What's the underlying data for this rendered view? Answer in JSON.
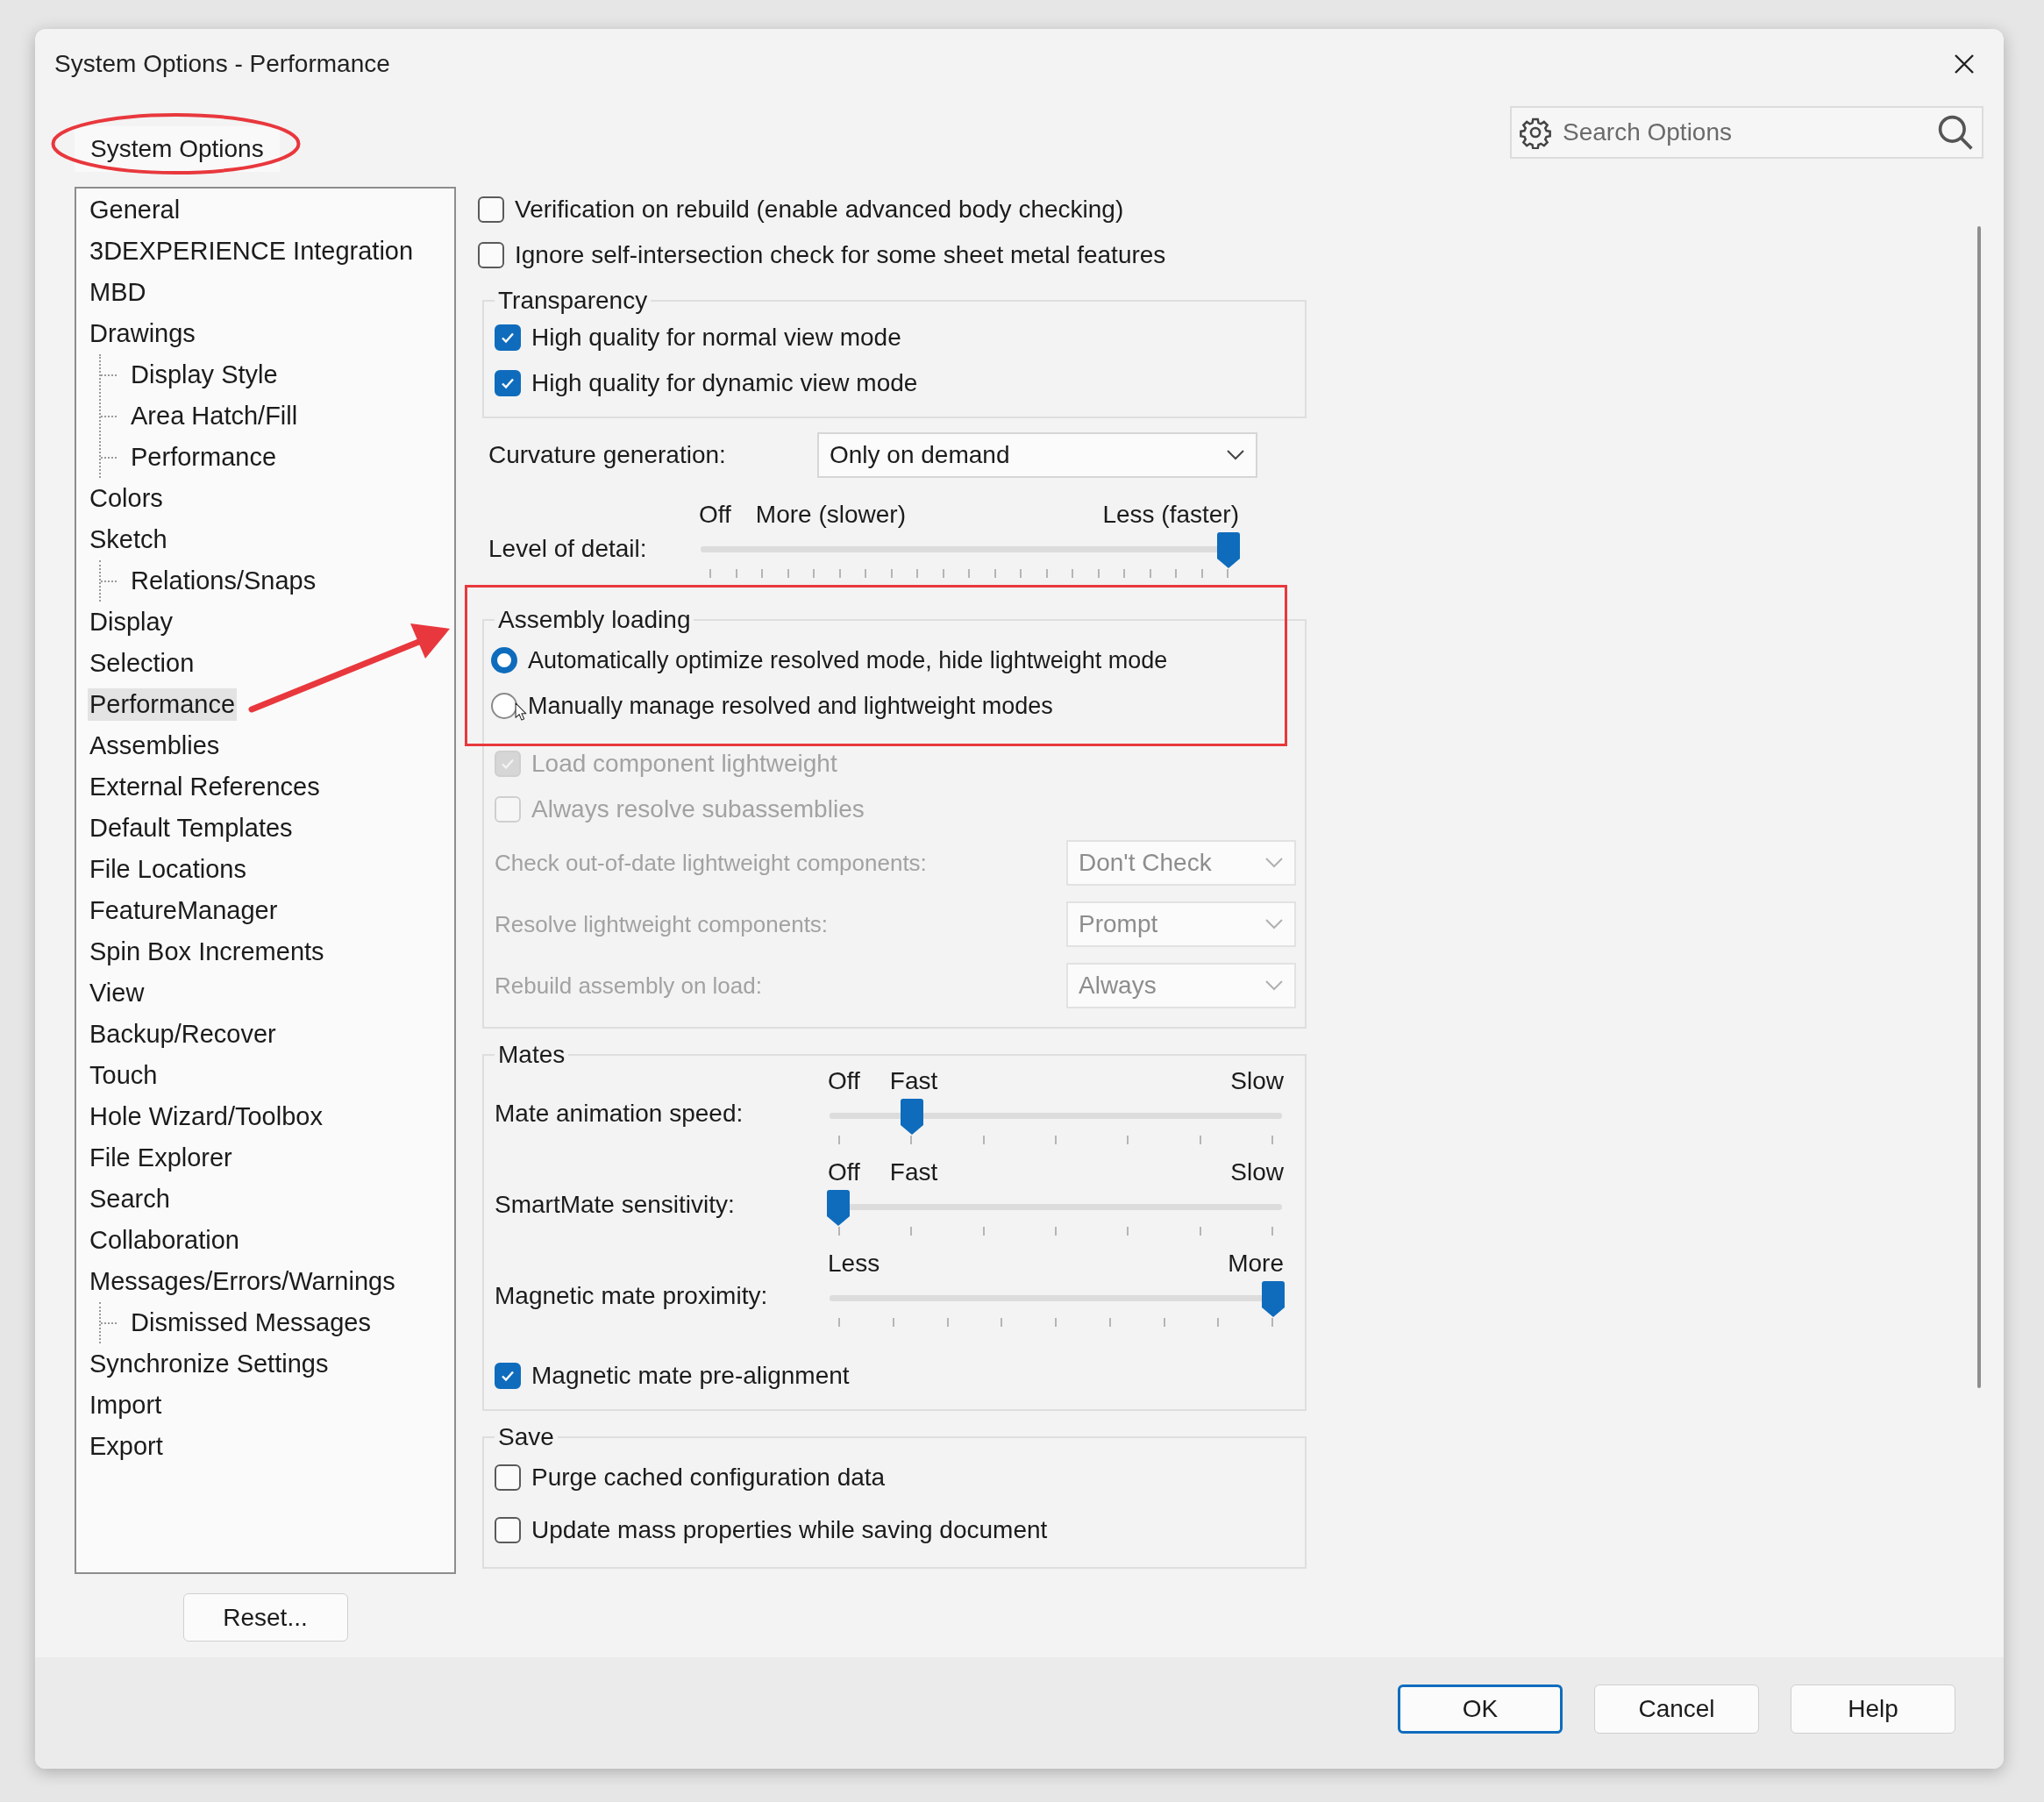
{
  "window": {
    "title": "System Options - Performance"
  },
  "tabs": [
    {
      "label": "System Options",
      "selected": true
    }
  ],
  "search": {
    "placeholder": "Search Options"
  },
  "tree": [
    {
      "label": "General",
      "selected": false
    },
    {
      "label": "3DEXPERIENCE Integration",
      "selected": false
    },
    {
      "label": "MBD",
      "selected": false
    },
    {
      "label": "Drawings",
      "selected": false,
      "children": [
        {
          "label": "Display Style",
          "selected": false
        },
        {
          "label": "Area Hatch/Fill",
          "selected": false
        },
        {
          "label": "Performance",
          "selected": false
        }
      ]
    },
    {
      "label": "Colors",
      "selected": false
    },
    {
      "label": "Sketch",
      "selected": false,
      "children": [
        {
          "label": "Relations/Snaps",
          "selected": false
        }
      ]
    },
    {
      "label": "Display",
      "selected": false
    },
    {
      "label": "Selection",
      "selected": false
    },
    {
      "label": "Performance",
      "selected": true
    },
    {
      "label": "Assemblies",
      "selected": false
    },
    {
      "label": "External References",
      "selected": false
    },
    {
      "label": "Default Templates",
      "selected": false
    },
    {
      "label": "File Locations",
      "selected": false
    },
    {
      "label": "FeatureManager",
      "selected": false
    },
    {
      "label": "Spin Box Increments",
      "selected": false
    },
    {
      "label": "View",
      "selected": false
    },
    {
      "label": "Backup/Recover",
      "selected": false
    },
    {
      "label": "Touch",
      "selected": false
    },
    {
      "label": "Hole Wizard/Toolbox",
      "selected": false
    },
    {
      "label": "File Explorer",
      "selected": false
    },
    {
      "label": "Search",
      "selected": false
    },
    {
      "label": "Collaboration",
      "selected": false
    },
    {
      "label": "Messages/Errors/Warnings",
      "selected": false,
      "children": [
        {
          "label": "Dismissed Messages",
          "selected": false
        }
      ]
    },
    {
      "label": "Synchronize Settings",
      "selected": false
    },
    {
      "label": "Import",
      "selected": false
    },
    {
      "label": "Export",
      "selected": false
    }
  ],
  "options": [
    {
      "label": "Verification on rebuild (enable advanced body checking)",
      "checked": false
    },
    {
      "label": "Ignore self-intersection check for some sheet metal features",
      "checked": false
    }
  ],
  "transparency": {
    "title": "Transparency",
    "options": [
      {
        "label": "High quality for normal view mode",
        "checked": true
      },
      {
        "label": "High quality for dynamic view mode",
        "checked": true
      }
    ]
  },
  "curvature": {
    "label": "Curvature generation:",
    "value": "Only on demand"
  },
  "level_of_detail": {
    "label": "Level of detail:",
    "scale_labels": [
      "Off",
      "More (slower)",
      "Less (faster)"
    ],
    "level": 1
  },
  "assembly_loading": {
    "title": "Assembly loading",
    "modes": [
      {
        "label": "Automatically optimize resolved mode, hide lightweight mode",
        "selected": true
      },
      {
        "label": "Manually manage resolved and lightweight modes",
        "selected": false
      }
    ],
    "options": [
      {
        "label": "Load component lightweight",
        "checked": true,
        "disabled": true
      },
      {
        "label": "Always resolve subassemblies",
        "checked": false,
        "disabled": true
      }
    ],
    "settings": [
      {
        "label": "Check out-of-date lightweight components:",
        "value": "Don't Check",
        "disabled": true
      },
      {
        "label": "Resolve lightweight components:",
        "value": "Prompt",
        "disabled": true
      },
      {
        "label": "Rebuild assembly on load:",
        "value": "Always",
        "disabled": true
      }
    ]
  },
  "mates": {
    "title": "Mates",
    "sliders": [
      {
        "label": "Mate animation speed:",
        "scale_labels": [
          "Off",
          "Fast",
          "Slow"
        ],
        "level": 0.17
      },
      {
        "label": "SmartMate sensitivity:",
        "scale_labels": [
          "Off",
          "Fast",
          "Slow"
        ],
        "level": 0
      },
      {
        "label": "Magnetic mate proximity:",
        "scale_labels": [
          "Less",
          "More"
        ],
        "level": 1
      }
    ],
    "options": [
      {
        "label": "Magnetic mate pre-alignment",
        "checked": true
      }
    ]
  },
  "save": {
    "title": "Save",
    "options": [
      {
        "label": "Purge cached configuration data",
        "checked": false
      },
      {
        "label": "Update mass properties while saving document",
        "checked": false
      }
    ]
  },
  "reset": "Reset...",
  "buttons": [
    {
      "label": "OK",
      "focused": true
    },
    {
      "label": "Cancel",
      "focused": false
    },
    {
      "label": "Help",
      "focused": false
    }
  ]
}
